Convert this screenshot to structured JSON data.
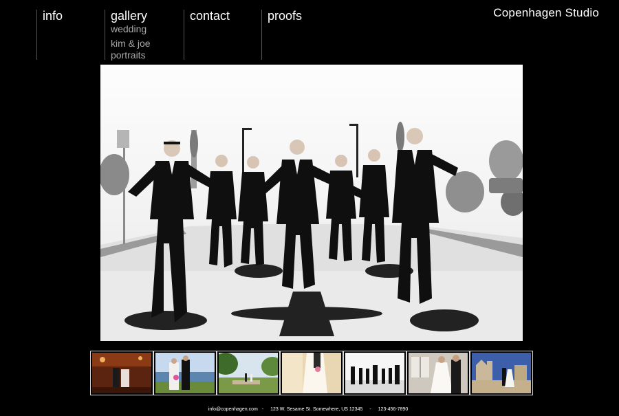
{
  "brand": "Copenhagen Studio",
  "nav": {
    "info": "info",
    "gallery": "gallery",
    "gallery_sub": [
      "wedding",
      "kim & joe",
      "portraits"
    ],
    "contact": "contact",
    "proofs": "proofs"
  },
  "footer": {
    "email": "info@copenhagen.com",
    "sep": "-",
    "address": "123 W. Sesame St. Somewhere, US 12345",
    "phone": "123-456-7890"
  },
  "colors": {
    "background": "#000000",
    "nav_text": "#ffffff",
    "subnav_text": "#a9a9a9",
    "divider": "#555555",
    "thumb_border": "#d8d8d8"
  },
  "thumbnails": [
    {
      "icon": "reception-dance-photo"
    },
    {
      "icon": "beach-couple-photo"
    },
    {
      "icon": "garden-ceremony-photo"
    },
    {
      "icon": "bride-dress-photo"
    },
    {
      "icon": "groomsmen-photo"
    },
    {
      "icon": "bride-window-photo"
    },
    {
      "icon": "castle-couple-photo"
    }
  ]
}
